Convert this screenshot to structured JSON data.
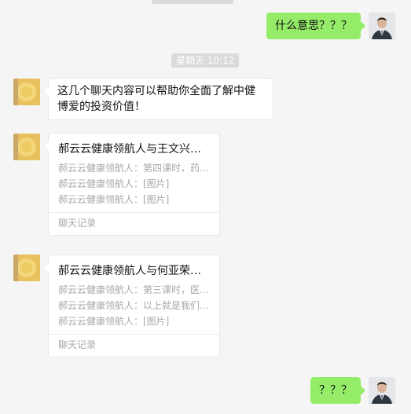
{
  "messages": {
    "m1_text": "什么意思？？？",
    "timestamp": "星期天 10:12",
    "m2_text": "这几个聊天内容可以帮助你全面了解中健博爱的投资价值！",
    "card1": {
      "title": "郝云云健康领航人与王文兴的...",
      "lines": [
        "郝云云健康领航人：第四课时，药者...",
        "郝云云健康领航人：[图片]",
        "郝云云健康领航人：[图片]"
      ],
      "footer": "聊天记录"
    },
    "card2": {
      "title": "郝云云健康领航人与何亚荣的...",
      "lines": [
        "郝云云健康领航人：第三课时，医改...",
        "郝云云健康领航人：以上就是我们今...",
        "郝云云健康领航人：[图片]"
      ],
      "footer": "聊天记录"
    },
    "m5_text": "？？？"
  },
  "icons": {
    "my_avatar": "user-avatar-icon",
    "contact_avatar": "contact-avatar-icon"
  },
  "colors": {
    "outgoing_bubble": "#95ec69",
    "incoming_bubble": "#ffffff",
    "background": "#f5f5f5"
  }
}
